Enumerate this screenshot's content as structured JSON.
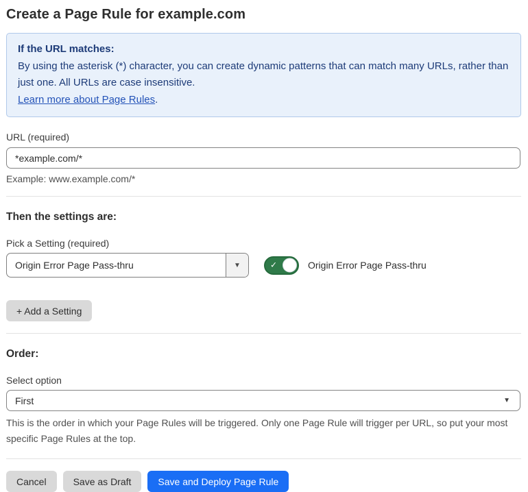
{
  "page": {
    "title": "Create a Page Rule for example.com"
  },
  "info_box": {
    "heading": "If the URL matches:",
    "body": "By using the asterisk (*) character, you can create dynamic patterns that can match many URLs, rather than just one. All URLs are case insensitive.",
    "link_label": "Learn more about Page Rules",
    "link_suffix": "."
  },
  "url_field": {
    "label": "URL (required)",
    "value": "*example.com/*",
    "example": "Example: www.example.com/*"
  },
  "settings_section": {
    "heading": "Then the settings are:",
    "picker_label": "Pick a Setting (required)",
    "selected_setting": "Origin Error Page Pass-thru",
    "toggle_label": "Origin Error Page Pass-thru",
    "toggle_state": "on",
    "add_setting_label": "+ Add a Setting"
  },
  "order_section": {
    "heading": "Order:",
    "select_label": "Select option",
    "selected_option": "First",
    "help_text": "This is the order in which your Page Rules will be triggered. Only one Page Rule will trigger per URL, so put your most specific Page Rules at the top."
  },
  "footer": {
    "cancel_label": "Cancel",
    "save_draft_label": "Save as Draft",
    "save_deploy_label": "Save and Deploy Page Rule"
  },
  "icons": {
    "dropdown_caret": "▼",
    "toggle_check": "✓"
  },
  "colors": {
    "info_box_bg": "#e9f1fb",
    "info_box_border": "#b0c9ea",
    "info_text": "#1d3b78",
    "link": "#2453b8",
    "primary_button": "#1a6ef5",
    "secondary_button": "#d9d9d9",
    "toggle_on": "#2f7a49",
    "divider": "#e2e2e2"
  }
}
